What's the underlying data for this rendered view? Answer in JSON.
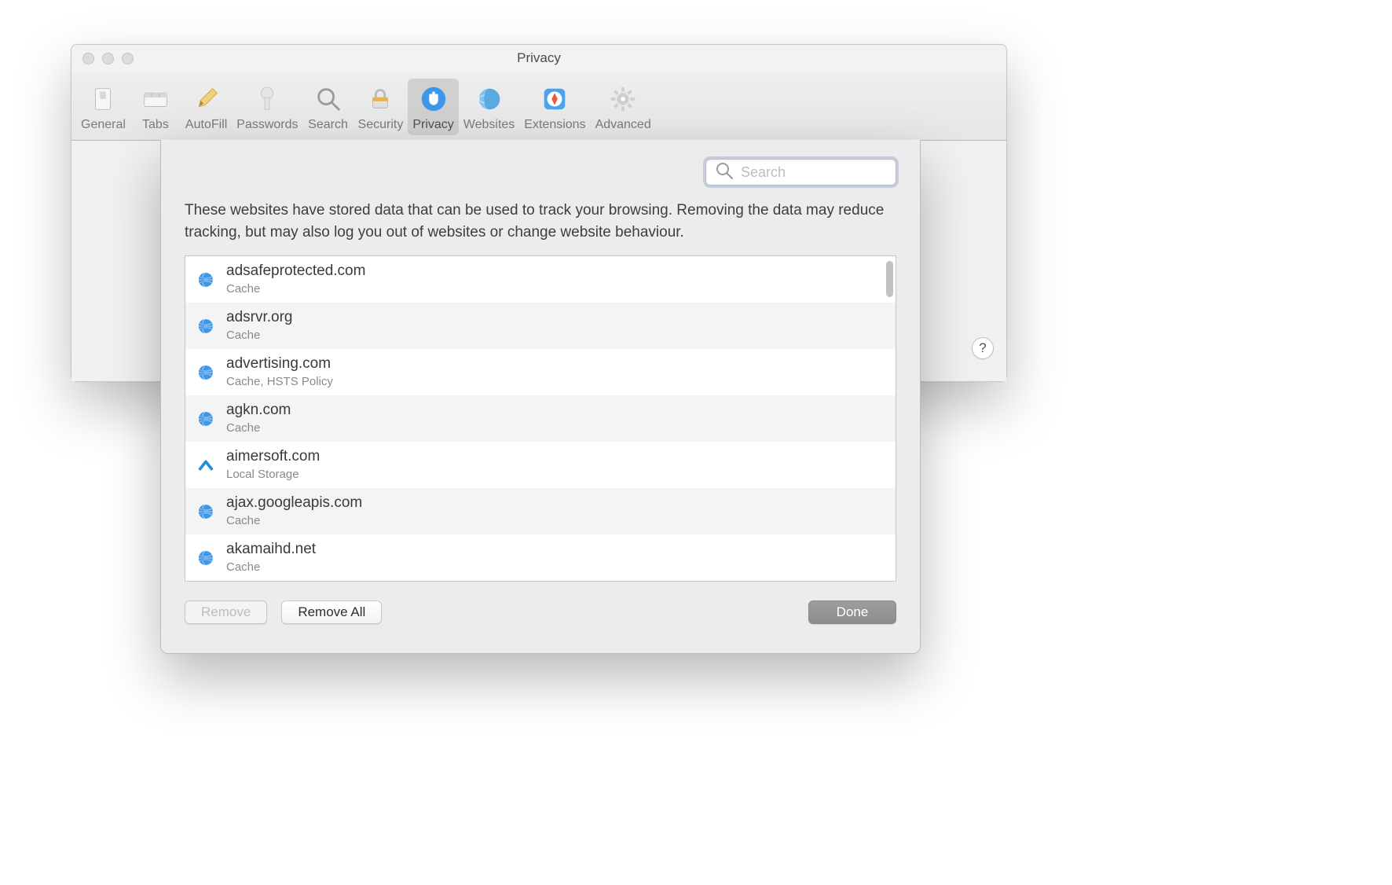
{
  "window": {
    "title": "Privacy"
  },
  "toolbar": {
    "items": [
      {
        "id": "general",
        "label": "General"
      },
      {
        "id": "tabs",
        "label": "Tabs"
      },
      {
        "id": "autofill",
        "label": "AutoFill"
      },
      {
        "id": "passwords",
        "label": "Passwords"
      },
      {
        "id": "search",
        "label": "Search"
      },
      {
        "id": "security",
        "label": "Security"
      },
      {
        "id": "privacy",
        "label": "Privacy",
        "selected": true
      },
      {
        "id": "websites",
        "label": "Websites"
      },
      {
        "id": "extensions",
        "label": "Extensions"
      },
      {
        "id": "advanced",
        "label": "Advanced"
      }
    ]
  },
  "help_symbol": "?",
  "sheet": {
    "search_placeholder": "Search",
    "description": "These websites have stored data that can be used to track your browsing. Removing the data may reduce tracking, but may also log you out of websites or change website behaviour.",
    "websites": [
      {
        "domain": "adsafeprotected.com",
        "detail": "Cache",
        "icon": "globe"
      },
      {
        "domain": "adsrvr.org",
        "detail": "Cache",
        "icon": "globe"
      },
      {
        "domain": "advertising.com",
        "detail": "Cache, HSTS Policy",
        "icon": "globe"
      },
      {
        "domain": "agkn.com",
        "detail": "Cache",
        "icon": "globe"
      },
      {
        "domain": "aimersoft.com",
        "detail": "Local Storage",
        "icon": "aimersoft"
      },
      {
        "domain": "ajax.googleapis.com",
        "detail": "Cache",
        "icon": "globe"
      },
      {
        "domain": "akamaihd.net",
        "detail": "Cache",
        "icon": "globe"
      }
    ],
    "buttons": {
      "remove": "Remove",
      "remove_all": "Remove All",
      "done": "Done"
    }
  }
}
